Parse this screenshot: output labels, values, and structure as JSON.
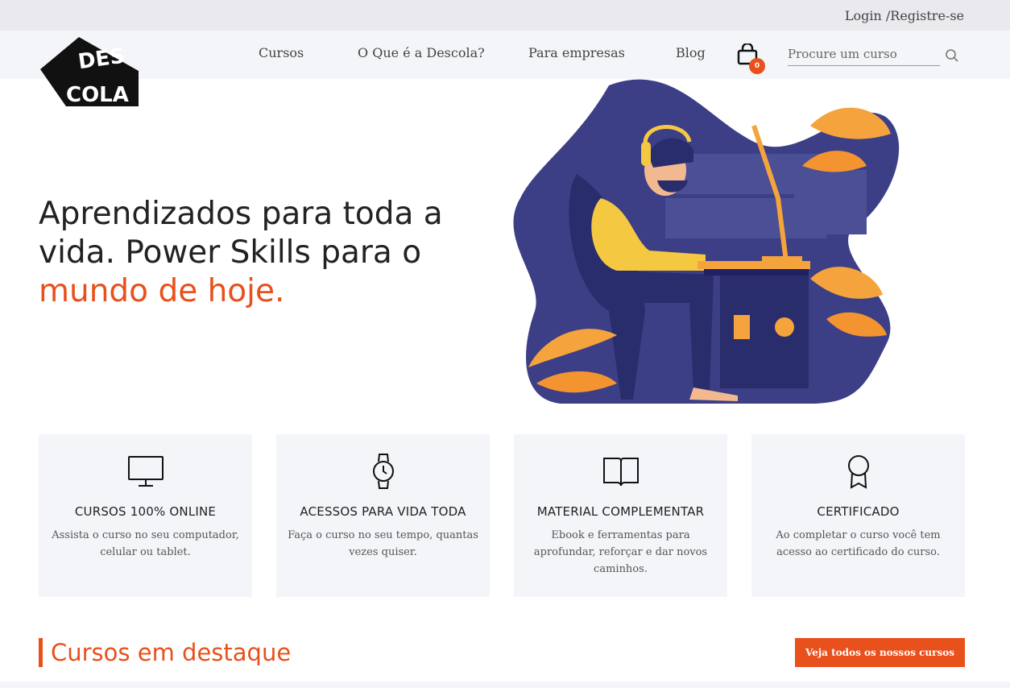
{
  "topbar": {
    "login_label": "Login /Registre-se"
  },
  "logo": {
    "text_top": "DES",
    "text_bottom": "COLA"
  },
  "nav": {
    "items": [
      {
        "label": "Cursos"
      },
      {
        "label": "O Que é a Descola?"
      },
      {
        "label": "Para empresas"
      },
      {
        "label": "Blog"
      }
    ],
    "cart_count": "0",
    "search_placeholder": "Procure um curso"
  },
  "hero": {
    "title_line1": "Aprendizados para toda a",
    "title_line2": "vida. Power Skills para o",
    "title_accent": "mundo de hoje."
  },
  "features": [
    {
      "icon": "monitor-icon",
      "title": "CURSOS 100% ONLINE",
      "text": "Assista o curso no seu computador, celular ou tablet."
    },
    {
      "icon": "watch-icon",
      "title": "ACESSOS PARA VIDA TODA",
      "text": "Faça o curso no seu tempo, quantas vezes quiser."
    },
    {
      "icon": "book-icon",
      "title": "MATERIAL COMPLEMENTAR",
      "text": "Ebook e ferramentas para aprofundar, reforçar e dar novos caminhos."
    },
    {
      "icon": "award-icon",
      "title": "CERTIFICADO",
      "text": "Ao completar o curso você tem acesso ao certificado do curso."
    }
  ],
  "featured": {
    "title": "Cursos em destaque",
    "cta_label": "Veja todos os nossos cursos"
  },
  "colors": {
    "accent": "#e8501c",
    "navy": "#3c3f86",
    "panel": "#f4f5f9",
    "topbar": "#e9e9ee"
  }
}
